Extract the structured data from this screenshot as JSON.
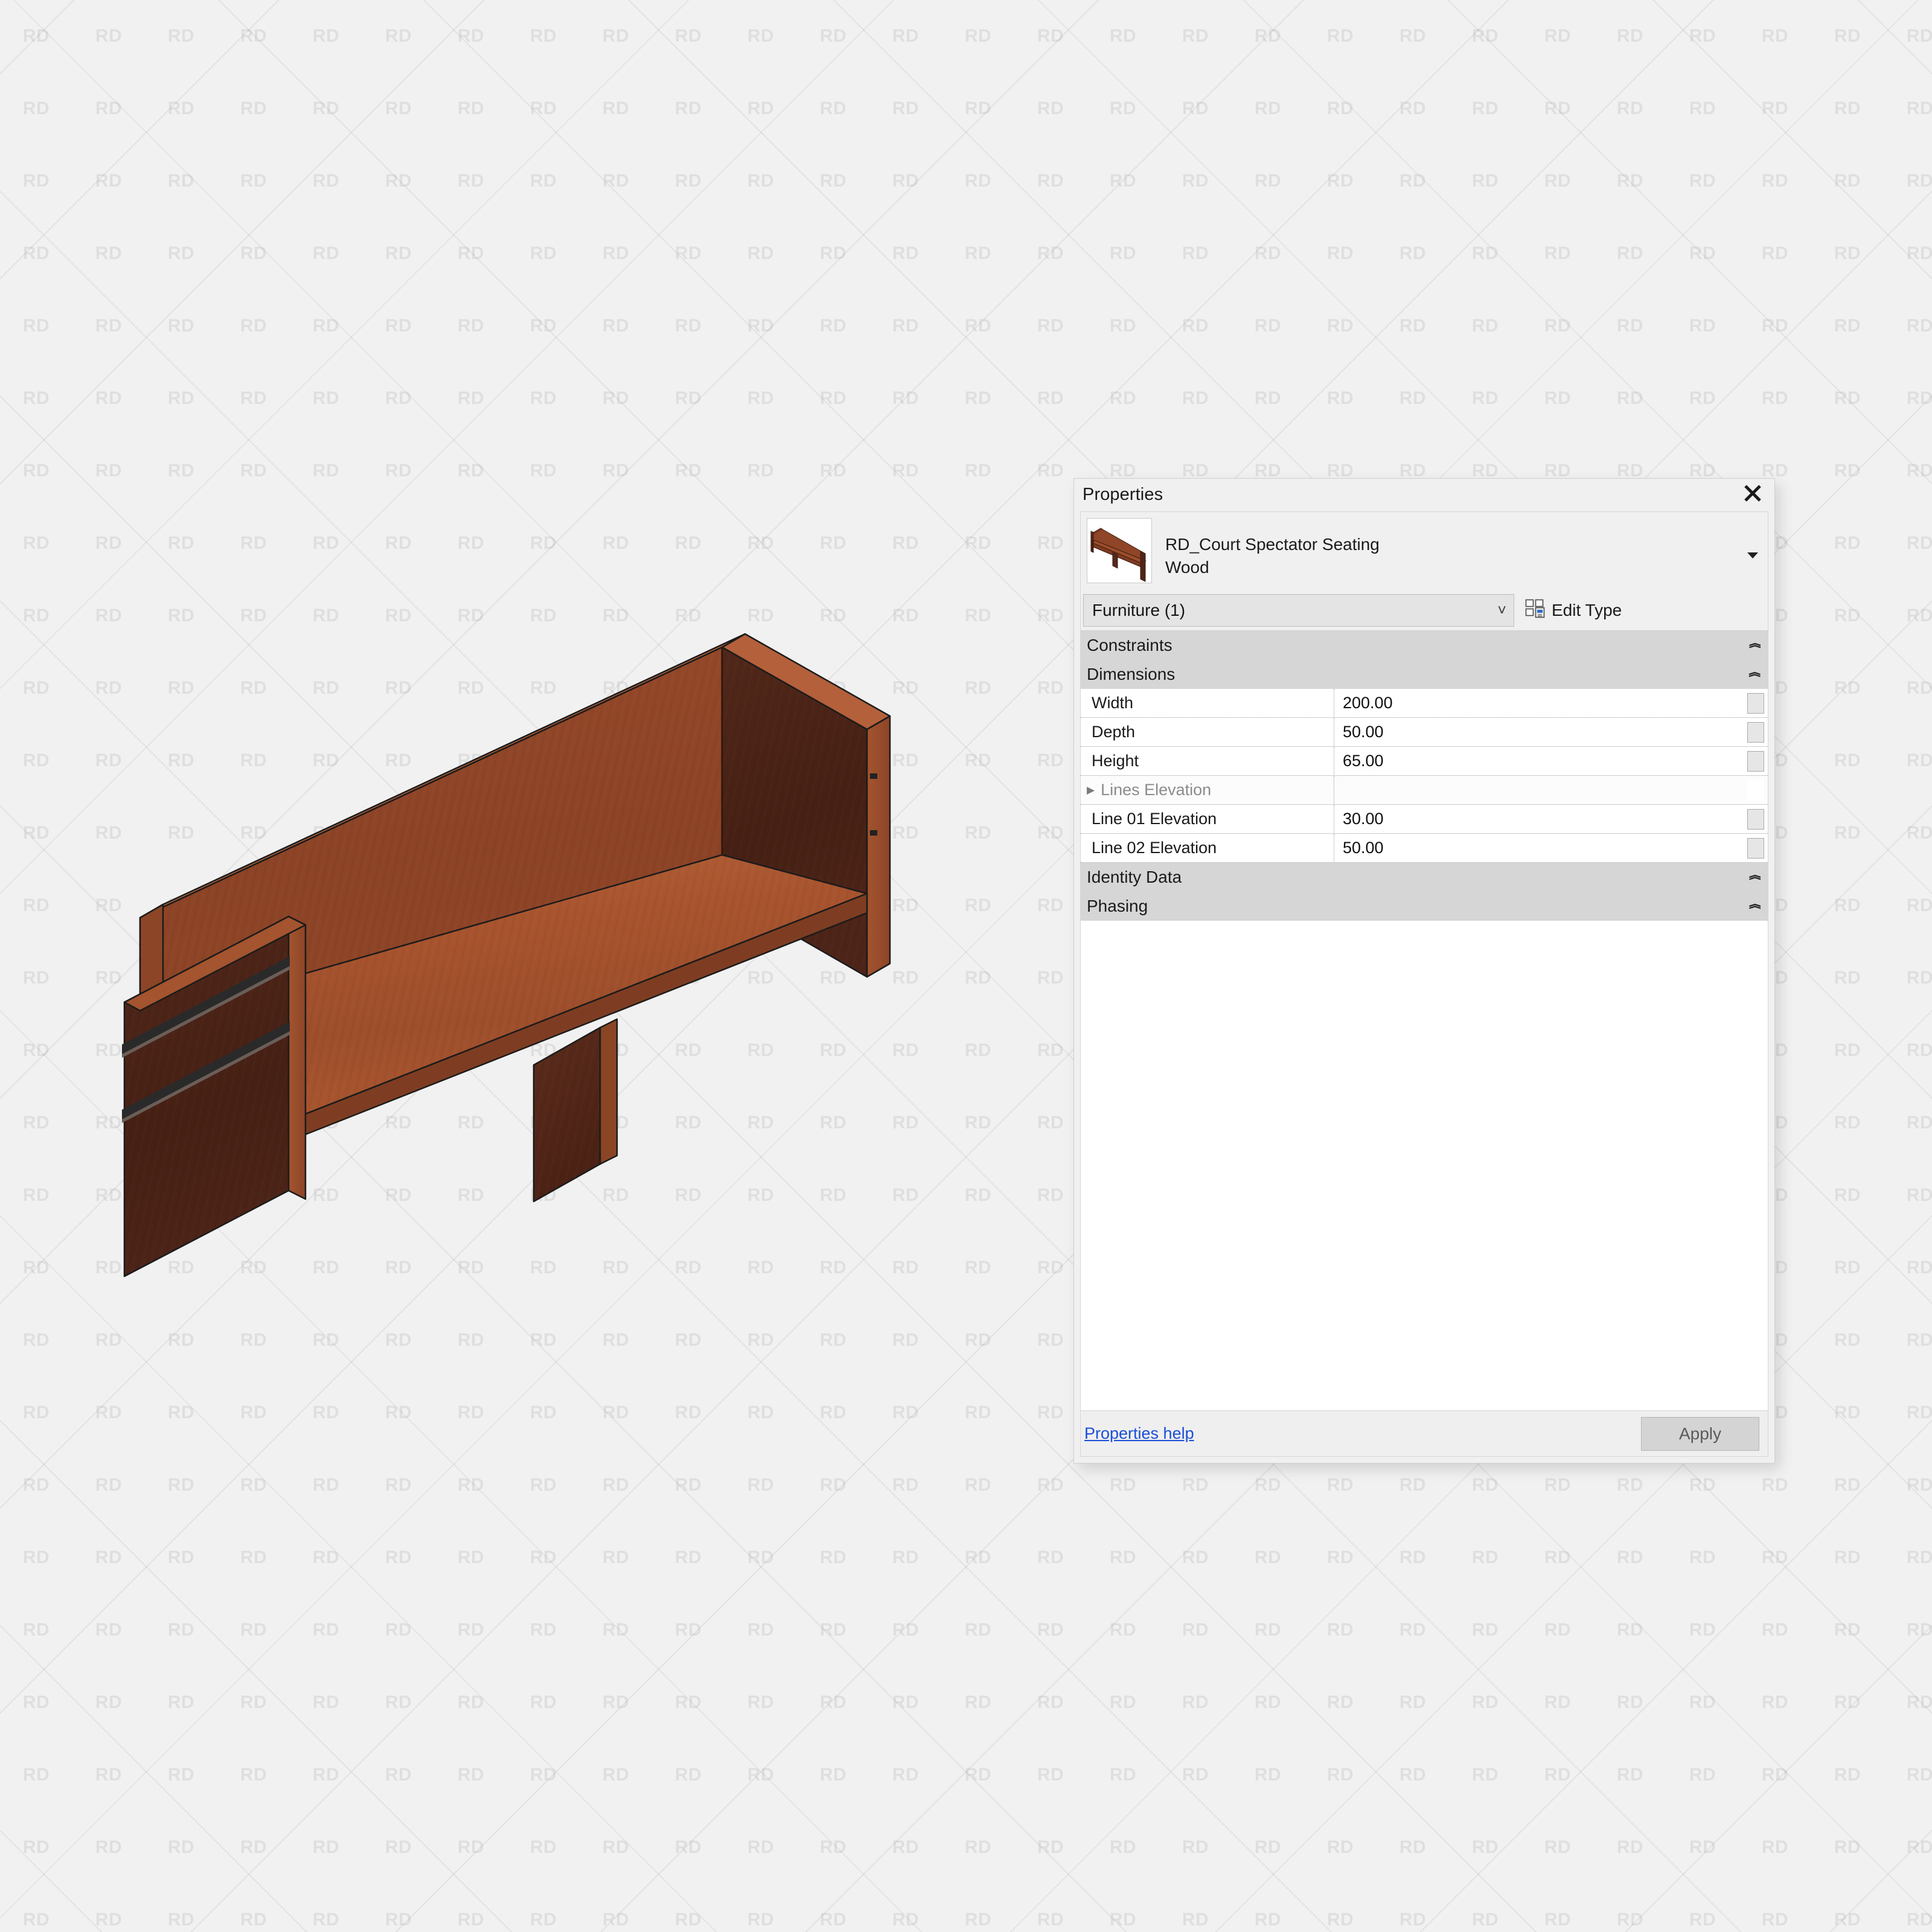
{
  "watermark": {
    "text": "RD"
  },
  "panel": {
    "title": "Properties",
    "close_icon": "close-icon",
    "type_name_line1": "RD_Court Spectator Seating",
    "type_name_line2": "Wood",
    "type_dropdown_icon": "triangle-down-icon",
    "thumbnail_icon": "bench-preview-thumbnail",
    "category_selector": {
      "value": "Furniture (1)",
      "caret_icon": "chevron-down-icon"
    },
    "edit_type": {
      "label": "Edit Type",
      "icon": "edit-type-icon"
    },
    "groups": [
      {
        "label": "Constraints",
        "state": "collapsed",
        "chevron": "chevron-double-down-icon"
      },
      {
        "label": "Dimensions",
        "state": "expanded",
        "chevron": "chevron-double-up-icon"
      }
    ],
    "parameters": [
      {
        "name": "Width",
        "value": "200.00",
        "kind": "value",
        "assoc": true
      },
      {
        "name": "Depth",
        "value": "50.00",
        "kind": "value",
        "assoc": true
      },
      {
        "name": "Height",
        "value": "65.00",
        "kind": "value",
        "assoc": true
      },
      {
        "name": "Lines Elevation",
        "value": "",
        "kind": "subgroup",
        "assoc": false,
        "expander": "triangle-right-icon"
      },
      {
        "name": "Line 01 Elevation",
        "value": "30.00",
        "kind": "value",
        "assoc": true
      },
      {
        "name": "Line 02 Elevation",
        "value": "50.00",
        "kind": "value",
        "assoc": true
      }
    ],
    "groups_lower": [
      {
        "label": "Identity Data",
        "state": "collapsed",
        "chevron": "chevron-double-down-icon"
      },
      {
        "label": "Phasing",
        "state": "collapsed",
        "chevron": "chevron-double-down-icon"
      }
    ],
    "footer": {
      "help_link": "Properties help",
      "apply_button": "Apply"
    }
  },
  "model": {
    "name": "court-spectator-seating-bench",
    "colors": {
      "seat_top": "#a5542f",
      "seat_top_light": "#b05c33",
      "back_inner": "#8e4326",
      "back_top_edge": "#b4603a",
      "end_panel_outer": "#4a2115",
      "end_panel_edge": "#9c4e2c",
      "leg_side": "#56281a",
      "groove": "#262626",
      "outline": "#1b1b1b"
    }
  }
}
